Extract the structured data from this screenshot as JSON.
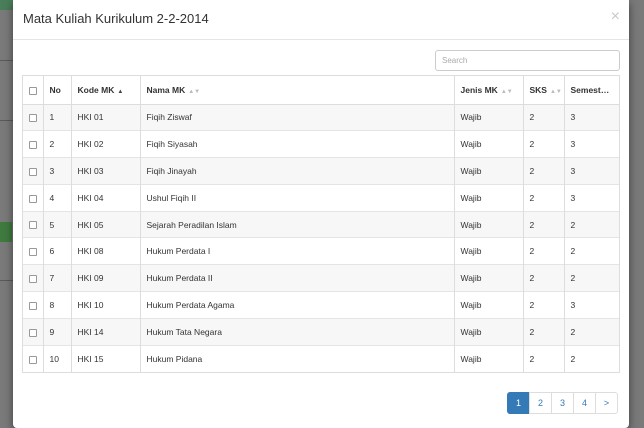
{
  "modal": {
    "title": "Mata Kuliah Kurikulum 2-2-2014",
    "close_label": "×",
    "search": {
      "placeholder": "Search",
      "value": ""
    }
  },
  "table": {
    "columns": [
      {
        "label": "No"
      },
      {
        "label": "Kode MK",
        "sort": "asc"
      },
      {
        "label": "Nama MK",
        "sort": "both"
      },
      {
        "label": "Jenis MK",
        "sort": "both"
      },
      {
        "label": "SKS",
        "sort": "both"
      },
      {
        "label": "Semest…",
        "sort": "both"
      }
    ],
    "rows": [
      {
        "no": "1",
        "kode": "HKI 01",
        "nama": "Fiqih Ziswaf",
        "jenis": "Wajib",
        "sks": "2",
        "semester": "3"
      },
      {
        "no": "2",
        "kode": "HKI 02",
        "nama": "Fiqih Siyasah",
        "jenis": "Wajib",
        "sks": "2",
        "semester": "3"
      },
      {
        "no": "3",
        "kode": "HKI 03",
        "nama": "Fiqih Jinayah",
        "jenis": "Wajib",
        "sks": "2",
        "semester": "3"
      },
      {
        "no": "4",
        "kode": "HKI 04",
        "nama": "Ushul Fiqih II",
        "jenis": "Wajib",
        "sks": "2",
        "semester": "3"
      },
      {
        "no": "5",
        "kode": "HKI 05",
        "nama": "Sejarah Peradilan Islam",
        "jenis": "Wajib",
        "sks": "2",
        "semester": "2"
      },
      {
        "no": "6",
        "kode": "HKI 08",
        "nama": "Hukum Perdata I",
        "jenis": "Wajib",
        "sks": "2",
        "semester": "2"
      },
      {
        "no": "7",
        "kode": "HKI 09",
        "nama": "Hukum Perdata II",
        "jenis": "Wajib",
        "sks": "2",
        "semester": "2"
      },
      {
        "no": "8",
        "kode": "HKI 10",
        "nama": "Hukum Perdata Agama",
        "jenis": "Wajib",
        "sks": "2",
        "semester": "3"
      },
      {
        "no": "9",
        "kode": "HKI 14",
        "nama": "Hukum Tata Negara",
        "jenis": "Wajib",
        "sks": "2",
        "semester": "2"
      },
      {
        "no": "10",
        "kode": "HKI 15",
        "nama": "Hukum Pidana",
        "jenis": "Wajib",
        "sks": "2",
        "semester": "2"
      }
    ]
  },
  "pagination": {
    "pages": [
      "1",
      "2",
      "3",
      "4"
    ],
    "next": ">",
    "current": "1"
  },
  "colors": {
    "accent": "#337ab7",
    "border": "#dddddd",
    "stripe": "#f7f7f7"
  }
}
